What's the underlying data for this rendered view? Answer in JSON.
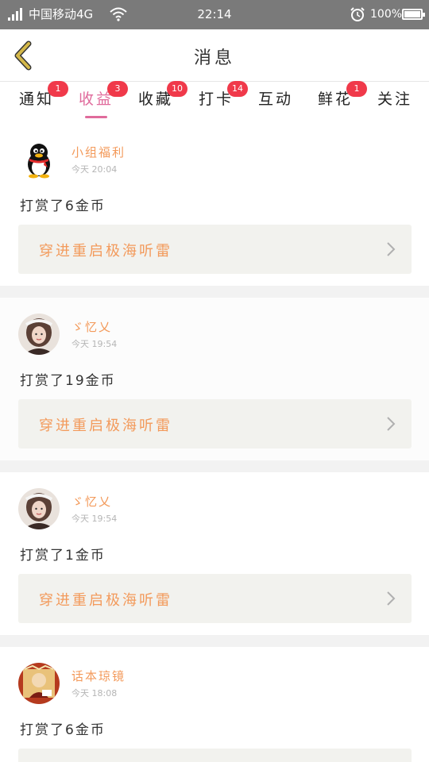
{
  "status_bar": {
    "carrier": "中国移动4G",
    "time": "22:14",
    "battery": "100%"
  },
  "header": {
    "title": "消息"
  },
  "tabs": [
    {
      "label": "通知",
      "badge": "1"
    },
    {
      "label": "收益",
      "badge": "3",
      "active": true
    },
    {
      "label": "收藏",
      "badge": "10"
    },
    {
      "label": "打卡",
      "badge": "14"
    },
    {
      "label": "互动",
      "badge": ""
    },
    {
      "label": "鲜花",
      "badge": "1"
    },
    {
      "label": "关注",
      "badge": ""
    }
  ],
  "feed": [
    {
      "user": "小组福利",
      "time": "今天 20:04",
      "message": "打赏了6金币",
      "book": "穿进重启极海听雷",
      "avatar": "qq-penguin"
    },
    {
      "user": "ゞ忆乂",
      "time": "今天 19:54",
      "message": "打赏了19金币",
      "book": "穿进重启极海听雷",
      "avatar": "girl-photo"
    },
    {
      "user": "ゞ忆乂",
      "time": "今天 19:54",
      "message": "打赏了1金币",
      "book": "穿进重启极海听雷",
      "avatar": "girl-photo"
    },
    {
      "user": "话本琼镜",
      "time": "今天 18:08",
      "message": "打赏了6金币",
      "book": "",
      "avatar": "drama-illustration"
    }
  ],
  "colors": {
    "accent_pink": "#e06b9c",
    "badge_red": "#f0394a",
    "name_orange": "#f39a5b",
    "back_arrow": "#d4b84a"
  }
}
